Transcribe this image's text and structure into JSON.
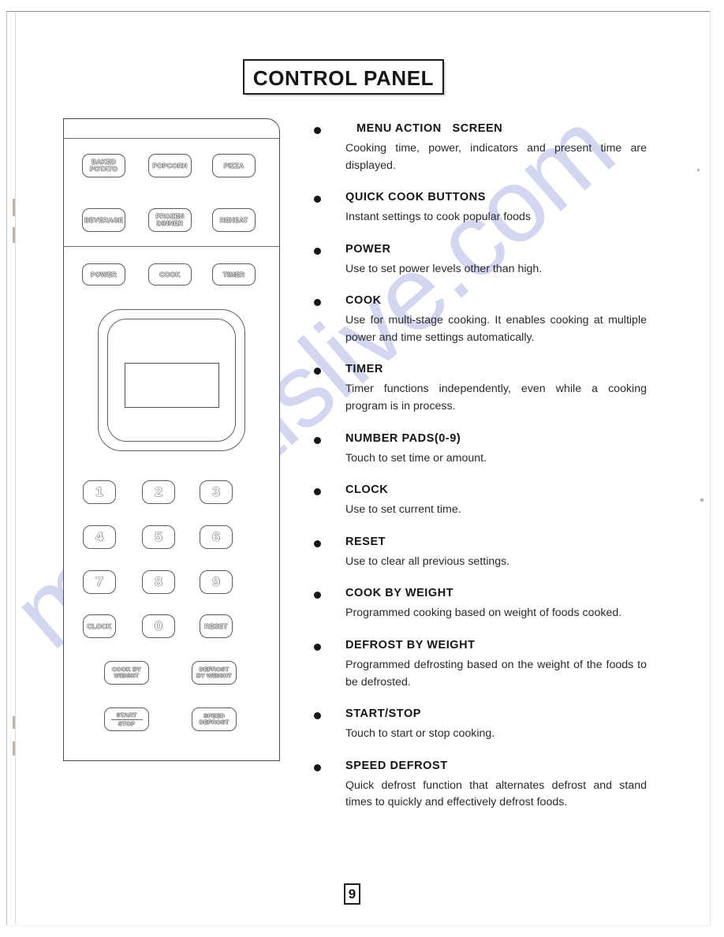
{
  "document": {
    "title": "CONTROL PANEL",
    "page_number": "9",
    "watermark": "manualslive.com"
  },
  "control_panel": {
    "quick_cook_row1": [
      {
        "label_lines": [
          "BAKED",
          "POTATO"
        ]
      },
      {
        "label_lines": [
          "POPCORN"
        ]
      },
      {
        "label_lines": [
          "PIZZA"
        ]
      }
    ],
    "quick_cook_row2": [
      {
        "label_lines": [
          "BEVERAGE"
        ]
      },
      {
        "label_lines": [
          "FROZEN",
          "DINNER"
        ]
      },
      {
        "label_lines": [
          "REHEAT"
        ]
      }
    ],
    "function_row": [
      {
        "label_lines": [
          "POWER"
        ]
      },
      {
        "label_lines": [
          "COOK"
        ]
      },
      {
        "label_lines": [
          "TIMER"
        ]
      }
    ],
    "number_pad": [
      "1",
      "2",
      "3",
      "4",
      "5",
      "6",
      "7",
      "8",
      "9"
    ],
    "number_pad_row4": [
      {
        "label_lines": [
          "CLOCK"
        ]
      },
      {
        "label_lines": [
          "0"
        ]
      },
      {
        "label_lines": [
          "RESET"
        ]
      }
    ],
    "bottom_buttons": [
      {
        "label_lines": [
          "COOK BY",
          "WEIGHT"
        ]
      },
      {
        "label_lines": [
          "DEFROST",
          "BY WEIGHT"
        ]
      },
      {
        "label_lines": [
          "START",
          "STOP"
        ]
      },
      {
        "label_lines": [
          "SPEED",
          "DEFROST"
        ]
      }
    ]
  },
  "features": [
    {
      "heading": "MENU ACTION   SCREEN",
      "body": "Cooking time, power, indicators and present time are displayed."
    },
    {
      "heading": "QUICK COOK BUTTONS",
      "body": "Instant settings to cook popular foods"
    },
    {
      "heading": "POWER",
      "body": "Use to set power levels other than high."
    },
    {
      "heading": "COOK",
      "body": "Use for multi-stage cooking.   It enables cooking at multiple power and time settings automatically."
    },
    {
      "heading": "TIMER",
      "body": "Timer functions independently, even while a cooking program is in process."
    },
    {
      "heading": "NUMBER PADS(0-9)",
      "body": "Touch to set time or amount."
    },
    {
      "heading": "CLOCK",
      "body": "Use to set current time."
    },
    {
      "heading": "RESET",
      "body": "Use to clear all previous settings."
    },
    {
      "heading": "COOK BY WEIGHT",
      "body": "Programmed cooking based on weight of foods cooked."
    },
    {
      "heading": "DEFROST BY WEIGHT",
      "body": "Programmed defrosting based on the weight of the foods to be defrosted."
    },
    {
      "heading": "START/STOP",
      "body": "Touch to start or stop cooking."
    },
    {
      "heading": "SPEED DEFROST",
      "body": "Quick defrost function that alternates defrost and stand times to quickly and effectively defrost foods."
    }
  ]
}
